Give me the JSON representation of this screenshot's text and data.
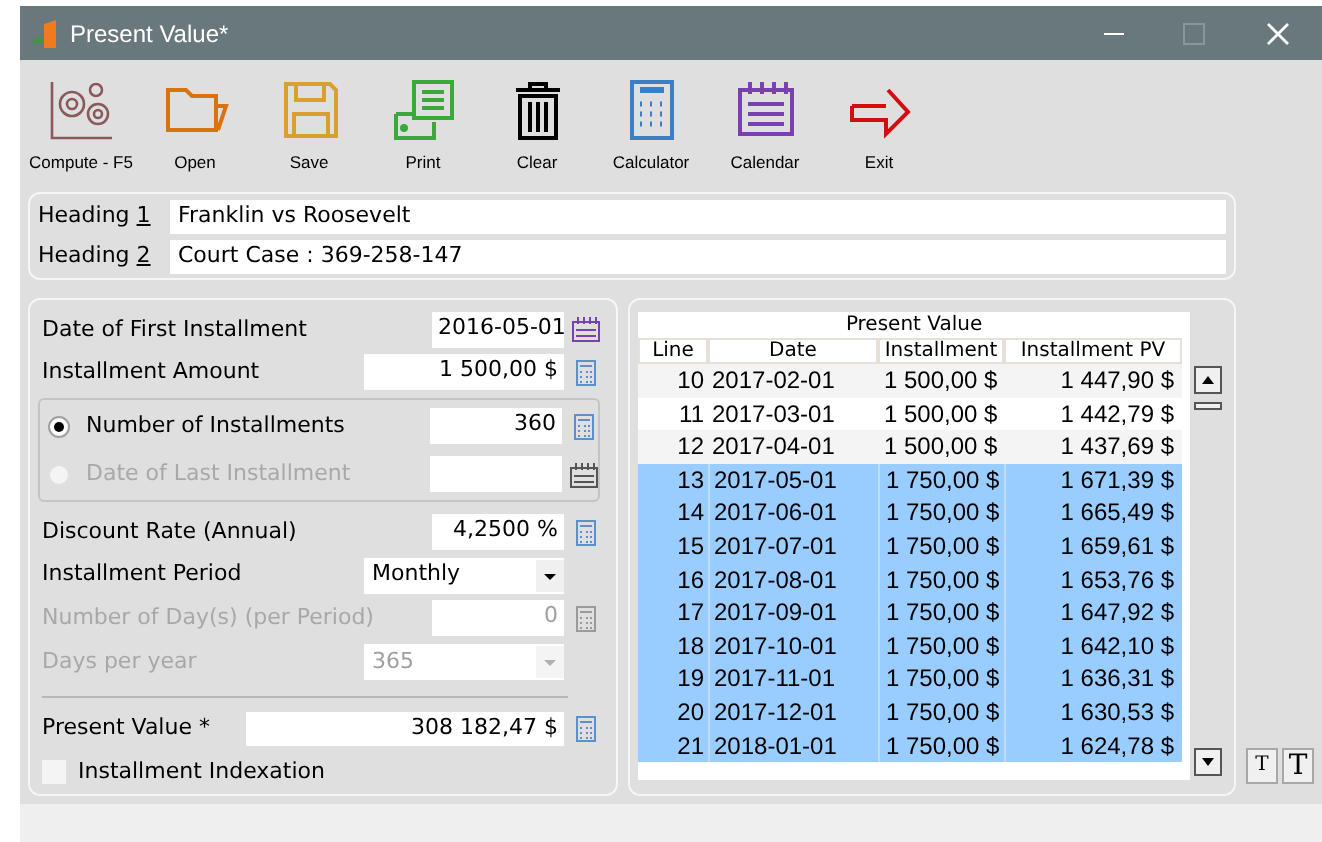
{
  "window": {
    "title": "Present Value*",
    "maximize_disabled": true
  },
  "toolbar": [
    {
      "kind": "gears",
      "label": "Compute - F5"
    },
    {
      "kind": "folder",
      "label": "Open"
    },
    {
      "kind": "disk",
      "label": "Save"
    },
    {
      "kind": "printer",
      "label": "Print"
    },
    {
      "kind": "trash",
      "label": "Clear"
    },
    {
      "kind": "calculator",
      "label": "Calculator"
    },
    {
      "kind": "notepad",
      "label": "Calendar"
    },
    {
      "kind": "exit",
      "label": "Exit"
    }
  ],
  "headings": [
    {
      "label": "Heading",
      "key": "1",
      "value": "Franklin vs Roosevelt"
    },
    {
      "label": "Heading",
      "key": "2",
      "value": "Court Case : 369-258-147"
    }
  ],
  "form": {
    "top_fields": [
      {
        "kind": "date",
        "label": "Date of First Installment",
        "value": "2016-05-01",
        "disabled": false
      },
      {
        "kind": "calc",
        "label": "Installment Amount",
        "value": "1 500,00 $",
        "disabled": false
      }
    ],
    "term_options": [
      {
        "kind": "calc",
        "label": "Number of Installments",
        "value": "360",
        "selected": true,
        "disabled": false
      },
      {
        "kind": "date",
        "label": "Date of Last Installment",
        "selected": false,
        "disabled": true
      }
    ],
    "rate_fields": [
      {
        "kind": "calc",
        "label": "Discount Rate (Annual)",
        "value": "4,2500 %",
        "disabled": false
      },
      {
        "kind": "select",
        "label": "Installment Period",
        "value": "Monthly",
        "disabled": false
      },
      {
        "kind": "calc",
        "label": "Number of Day(s) (per Period)",
        "value": "0",
        "disabled": true
      },
      {
        "kind": "select",
        "label": "Days per year",
        "value": "365",
        "disabled": true
      }
    ],
    "present_value": {
      "label": "Present Value *",
      "value": "308 182,47 $"
    },
    "indexation": {
      "label": "Installment Indexation",
      "checked": false
    }
  },
  "table": {
    "title": "Present Value",
    "columns": [
      "Line",
      "Date",
      "Installment",
      "Installment PV"
    ],
    "rows": [
      {
        "cells": [
          "10",
          "2017-02-01",
          "1 500,00 $",
          "1 447,90 $"
        ],
        "selected": false
      },
      {
        "cells": [
          "11",
          "2017-03-01",
          "1 500,00 $",
          "1 442,79 $"
        ],
        "selected": false
      },
      {
        "cells": [
          "12",
          "2017-04-01",
          "1 500,00 $",
          "1 437,69 $"
        ],
        "selected": false
      },
      {
        "cells": [
          "13",
          "2017-05-01",
          "1 750,00 $",
          "1 671,39 $"
        ],
        "selected": true
      },
      {
        "cells": [
          "14",
          "2017-06-01",
          "1 750,00 $",
          "1 665,49 $"
        ],
        "selected": true
      },
      {
        "cells": [
          "15",
          "2017-07-01",
          "1 750,00 $",
          "1 659,61 $"
        ],
        "selected": true
      },
      {
        "cells": [
          "16",
          "2017-08-01",
          "1 750,00 $",
          "1 653,76 $"
        ],
        "selected": true
      },
      {
        "cells": [
          "17",
          "2017-09-01",
          "1 750,00 $",
          "1 647,92 $"
        ],
        "selected": true
      },
      {
        "cells": [
          "18",
          "2017-10-01",
          "1 750,00 $",
          "1 642,10 $"
        ],
        "selected": true
      },
      {
        "cells": [
          "19",
          "2017-11-01",
          "1 750,00 $",
          "1 636,31 $"
        ],
        "selected": true
      },
      {
        "cells": [
          "20",
          "2017-12-01",
          "1 750,00 $",
          "1 630,53 $"
        ],
        "selected": true
      },
      {
        "cells": [
          "21",
          "2018-01-01",
          "1 750,00 $",
          "1 624,78 $"
        ],
        "selected": true
      }
    ]
  },
  "font_buttons": [
    "T",
    "T"
  ]
}
